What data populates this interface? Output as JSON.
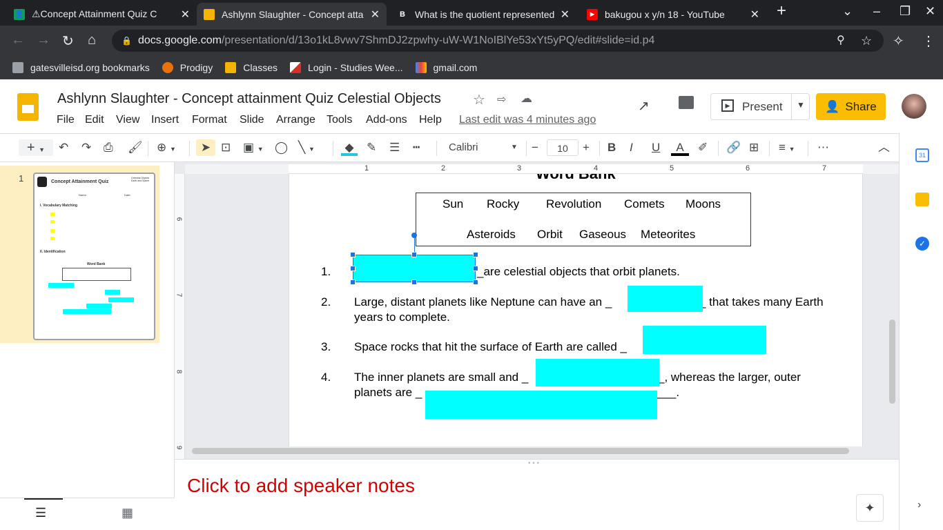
{
  "browser": {
    "tabs": [
      {
        "title": "⚠Concept Attainment Quiz C",
        "active": false
      },
      {
        "title": "Ashlynn Slaughter - Concept atta",
        "active": true
      },
      {
        "title": "What is the quotient represented",
        "active": false
      },
      {
        "title": "bakugou x y/n 18 - YouTube",
        "active": false
      }
    ],
    "url_host": "docs.google.com",
    "url_path": "/presentation/d/13o1kL8vwv7ShmDJ2zpwhy-uW-W1NoIBlYe53xYt5yPQ/edit#slide=id.p4",
    "bookmarks": [
      "gatesvilleisd.org bookmarks",
      "Prodigy",
      "Classes",
      "Login - Studies Wee...",
      "gmail.com"
    ]
  },
  "app": {
    "title": "Ashlynn Slaughter - Concept attainment Quiz Celestial Objects",
    "menu": [
      "File",
      "Edit",
      "View",
      "Insert",
      "Format",
      "Slide",
      "Arrange",
      "Tools",
      "Add-ons",
      "Help"
    ],
    "last_edit": "Last edit was 4 minutes ago",
    "present_label": "Present",
    "share_label": "Share"
  },
  "toolbar": {
    "font": "Calibri",
    "font_size": "10"
  },
  "filmstrip": {
    "slide_number": "1",
    "thumb": {
      "title": "Concept Attainment Quiz",
      "corner": "Celestial Objects Earth and Space",
      "name": "Name:",
      "date": "Date:",
      "section1": "I. Vocabulary Matching",
      "section2": "II. Identification",
      "wordbank": "Word Bank"
    }
  },
  "ruler": {
    "h": [
      "1",
      "2",
      "3",
      "4",
      "5",
      "6",
      "7"
    ],
    "v": [
      "6",
      "7",
      "8",
      "9"
    ]
  },
  "slide": {
    "wordbank_title": "Word Bank",
    "wordbank_row1": [
      "Sun",
      "Rocky",
      "Revolution",
      "Comets",
      "Moons"
    ],
    "wordbank_row2": [
      "Asteroids",
      "Orbit",
      "Gaseous",
      "Meteorites"
    ],
    "items": [
      {
        "num": "1.",
        "text": "_are celestial objects that orbit planets."
      },
      {
        "num": "2.",
        "text_a": "Large, distant planets like Neptune can have an _",
        "text_b": "_ that takes many Earth",
        "text_c": "years to complete."
      },
      {
        "num": "3.",
        "text": "Space rocks that hit the surface of Earth are called _"
      },
      {
        "num": "4.",
        "text_a": "The inner planets are small and _",
        "text_b": "_, whereas the larger, outer",
        "text_c": "planets are _",
        "text_d": "___."
      }
    ],
    "blank_color": "#00ffff"
  },
  "notes": {
    "placeholder": "Click to add speaker notes"
  }
}
